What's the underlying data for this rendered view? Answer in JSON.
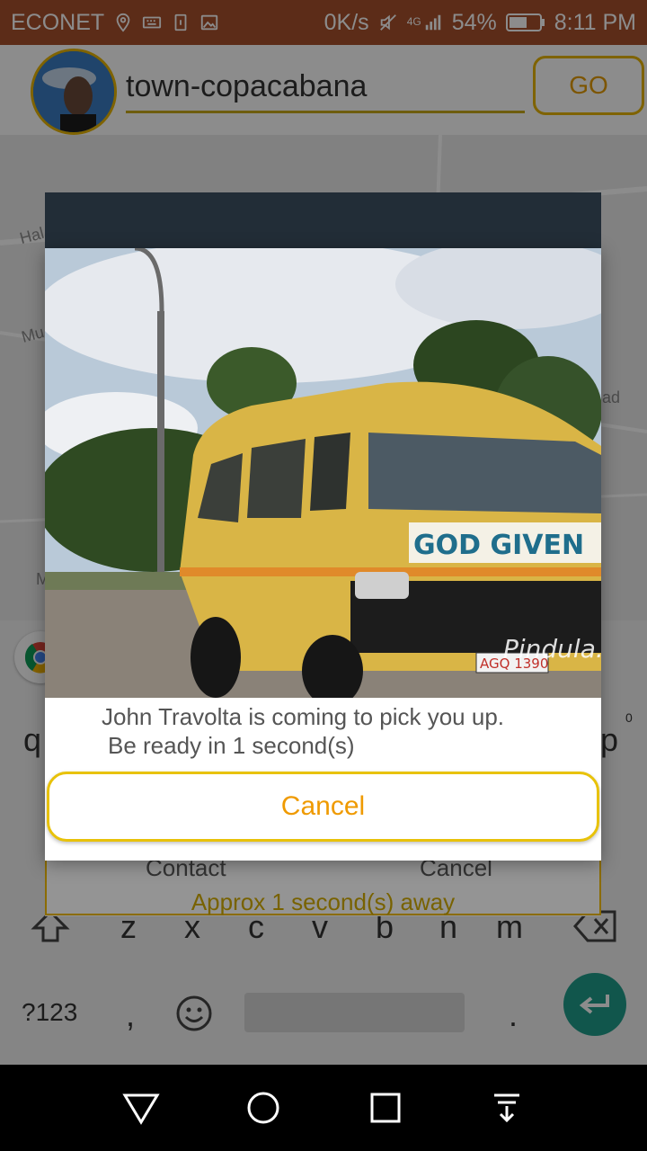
{
  "status_bar": {
    "carrier": "ECONET",
    "net_speed": "0K/s",
    "network_type": "4G",
    "battery": "54%",
    "time": "8:11 PM"
  },
  "header": {
    "search_value": "town-copacabana",
    "go_label": "GO"
  },
  "map": {
    "labels": [
      "Hal",
      "Mu",
      "ad",
      "M"
    ]
  },
  "keyboard": {
    "row_top_left": "q",
    "row_top_right": "p",
    "superscript": "0",
    "bottom_row": [
      "z",
      "x",
      "c",
      "v",
      "b",
      "n",
      "m"
    ],
    "symbols_label": "?123",
    "comma_label": ",",
    "period_label": "."
  },
  "driver_card": {
    "contact_label": "Contact",
    "cancel_label": "Cancel",
    "eta_text": "Approx 1 second(s) away"
  },
  "dialog": {
    "message_line1": "John Travolta is coming to pick you up.",
    "message_line2": "Be ready in 1 second(s)",
    "cancel_label": "Cancel",
    "vehicle_text": "GOD GIVEN",
    "plate_text": "AGQ 1390",
    "watermark": "Pindula.c"
  },
  "colors": {
    "status_bar_bg": "#a8502d",
    "accent_yellow": "#e8b400",
    "cancel_text": "#ef9a00",
    "enter_key": "#1f9d8a"
  }
}
